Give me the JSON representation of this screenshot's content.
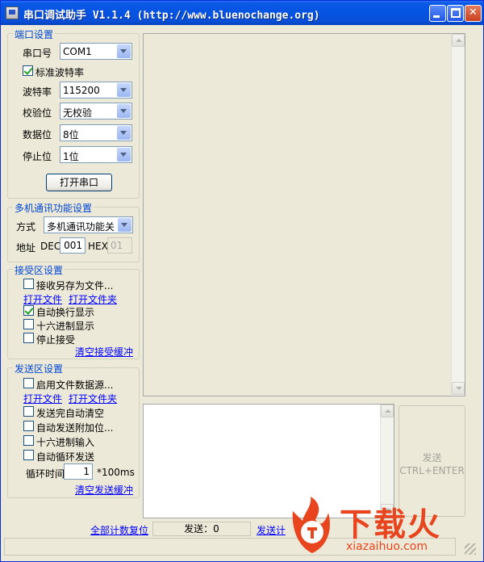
{
  "window": {
    "title": "串口调试助手 V1.1.4 (http://www.bluenochange.org)"
  },
  "port_settings": {
    "legend": "端口设置",
    "port_label": "串口号",
    "port_value": "COM1",
    "std_baud_label": "标准波特率",
    "std_baud_checked": true,
    "baud_label": "波特率",
    "baud_value": "115200",
    "parity_label": "校验位",
    "parity_value": "无校验",
    "databits_label": "数据位",
    "databits_value": "8位",
    "stopbits_label": "停止位",
    "stopbits_value": "1位",
    "open_button": "打开串口"
  },
  "multi": {
    "legend": "多机通讯功能设置",
    "mode_label": "方式",
    "mode_value": "多机通讯功能关",
    "addr_label": "地址",
    "dec_label": "DEC",
    "dec_value": "001",
    "hex_label": "HEX",
    "hex_value": "01"
  },
  "receive": {
    "legend": "接受区设置",
    "save_as_file": "接收另存为文件...",
    "save_as_file_checked": false,
    "open_file": "打开文件",
    "open_folder": "打开文件夹",
    "auto_newline": "自动换行显示",
    "auto_newline_checked": true,
    "hex_display": "十六进制显示",
    "hex_display_checked": false,
    "stop_receive": "停止接受",
    "stop_receive_checked": false,
    "clear": "清空接受缓冲"
  },
  "send": {
    "legend": "发送区设置",
    "file_source": "启用文件数据源...",
    "file_source_checked": false,
    "open_file": "打开文件",
    "open_folder": "打开文件夹",
    "auto_clear": "发送完自动清空",
    "auto_clear_checked": false,
    "auto_append": "自动发送附加位...",
    "auto_append_checked": false,
    "hex_input": "十六进制输入",
    "hex_input_checked": false,
    "auto_loop": "自动循环发送",
    "auto_loop_checked": false,
    "loop_label": "循环时间",
    "loop_value": "1",
    "loop_unit": "*100ms",
    "clear": "清空发送缓冲"
  },
  "send_button": {
    "line1": "发送",
    "line2": "CTRL+ENTER"
  },
  "counters": {
    "reset": "全部计数复位",
    "sent": "发送：0",
    "sent_count_link": "发送计"
  },
  "watermark": {
    "brand": "下载火",
    "url": "xiazaihuo.com"
  },
  "colors": {
    "titlebar": "#0553e1",
    "legend_text": "#0046d5",
    "link": "#0000ff",
    "watermark": "#e8451e"
  }
}
